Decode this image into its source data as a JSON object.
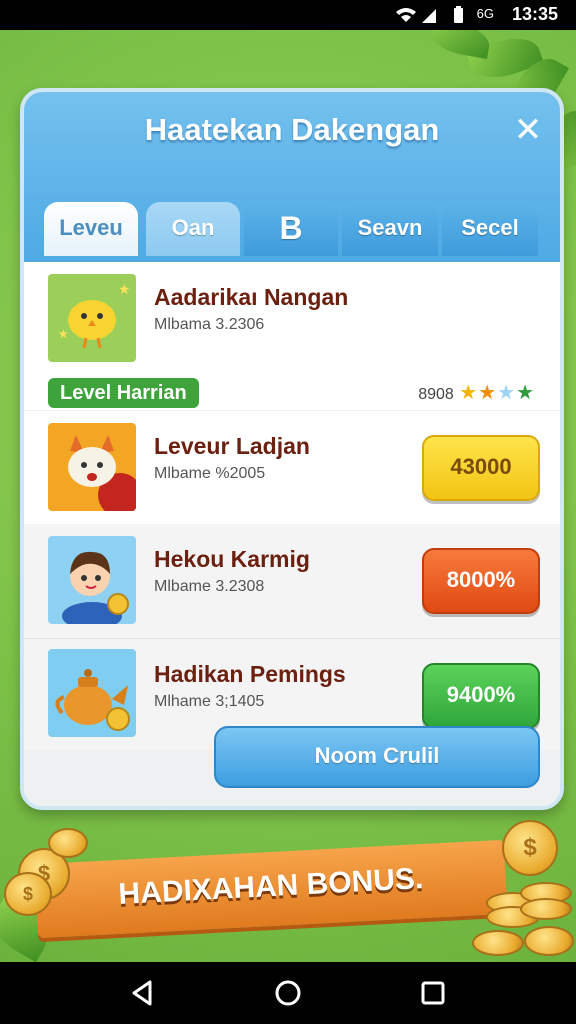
{
  "status_bar": {
    "network": "6G",
    "time": "13:35"
  },
  "dialog": {
    "title": "Haatekan Dakengan",
    "tabs": [
      {
        "label": "Leveu"
      },
      {
        "label": "Oan"
      },
      {
        "label": "B"
      },
      {
        "label": "Seavn"
      },
      {
        "label": "Secel"
      }
    ],
    "featured": {
      "title": "Aadarikaı Nangan",
      "subtitle": "Mlbama 3.2306"
    },
    "level_section": {
      "label": "Level Harrian",
      "score": "8908",
      "star_colors": [
        "#f5b400",
        "#f08c00",
        "#9fd3f5",
        "#2e9b3a"
      ]
    },
    "rows": [
      {
        "title": "Leveur Ladjan",
        "subtitle": "Mlbame %2005",
        "value": "43000",
        "color": "#f6d21a"
      },
      {
        "title": "Hekou Karmig",
        "subtitle": "Mlbame 3.2308",
        "value": "8000%",
        "color": "#ee5a1e"
      },
      {
        "title": "Hadikan Pemings",
        "subtitle": "Mlhame 3;1405",
        "value": "9400%",
        "color": "#3bb44a"
      }
    ],
    "footer_button": "Noom Crulil"
  },
  "banner": {
    "text": "HADIXAHAN BONUS."
  }
}
